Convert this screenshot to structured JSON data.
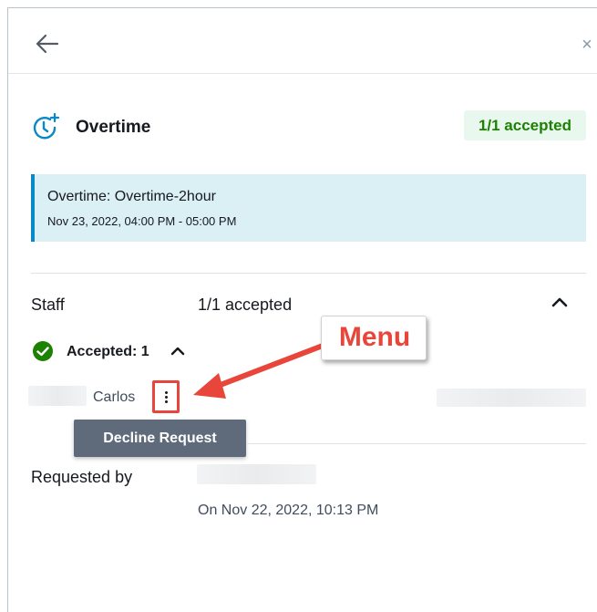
{
  "header": {
    "back_icon": "arrow-left-icon",
    "close_icon": "close-icon",
    "close_glyph": "×"
  },
  "request": {
    "icon": "clock-plus-icon",
    "title": "Overtime",
    "status_badge": "1/1 accepted",
    "info_title": "Overtime: Overtime-2hour",
    "info_time": "Nov 23, 2022, 04:00 PM - 05:00 PM"
  },
  "staff": {
    "label": "Staff",
    "count": "1/1 accepted",
    "accepted_label": "Accepted: 1",
    "member_name": "Carlos",
    "menu_icon": "kebab-menu-icon",
    "menu_items": [
      "Decline Request"
    ]
  },
  "requested_by": {
    "label": "Requested by",
    "date": "On Nov 22, 2022, 10:13 PM"
  },
  "annotation": {
    "callout_text": "Menu"
  },
  "colors": {
    "accent_blue": "#0a88c7",
    "success_green": "#1d8102",
    "badge_bg": "#e9f8ee",
    "info_bg": "#dbf0f5",
    "annotation_red": "#e8463a",
    "dropdown_bg": "#5f6b7a"
  }
}
